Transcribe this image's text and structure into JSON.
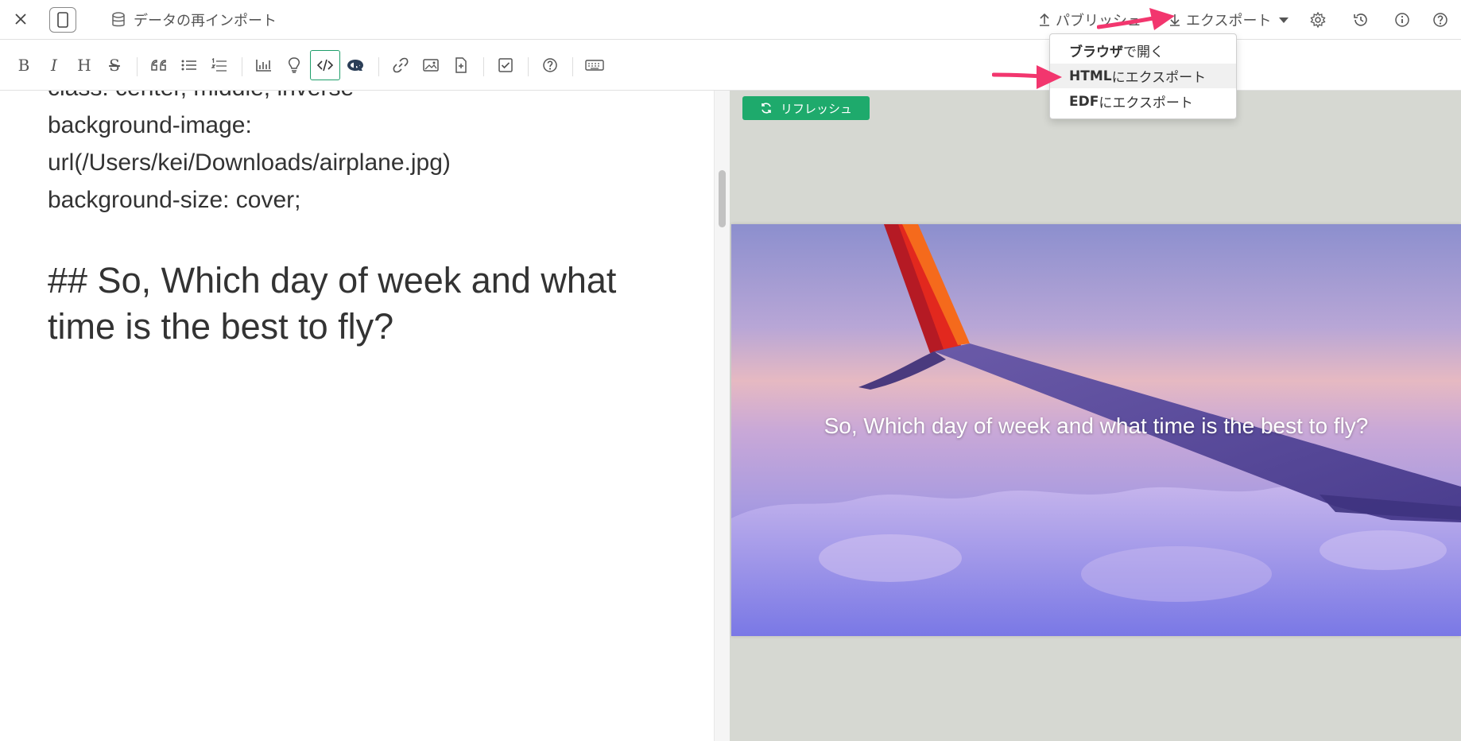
{
  "topbar": {
    "reimport_label": "データの再インポート",
    "publish_label": "パブリッシュ",
    "export_label": "エクスポート"
  },
  "toolbar": {
    "bold": "B",
    "italic": "I",
    "heading": "H",
    "strike": "S"
  },
  "editor": {
    "lines": [
      "class: center, middle, inverse",
      "background-image:",
      "url(/Users/kei/Downloads/airplane.jpg)",
      "background-size: cover;"
    ],
    "heading": "## So, Which day of week and what time is the best to fly?"
  },
  "preview": {
    "refresh_label": "リフレッシュ",
    "slide_title": "So, Which day of week and what time is the best to fly?"
  },
  "export_menu": {
    "items": [
      {
        "bold": "ブラウザ",
        "rest": "で開く"
      },
      {
        "bold": "HTML",
        "rest": "にエクスポート"
      },
      {
        "bold": "EDF",
        "rest": "にエクスポート"
      }
    ]
  },
  "colors": {
    "accent_green": "#1eaa6c",
    "annotation_arrow": "#f2366e",
    "preview_bg": "#d6d8d2"
  }
}
